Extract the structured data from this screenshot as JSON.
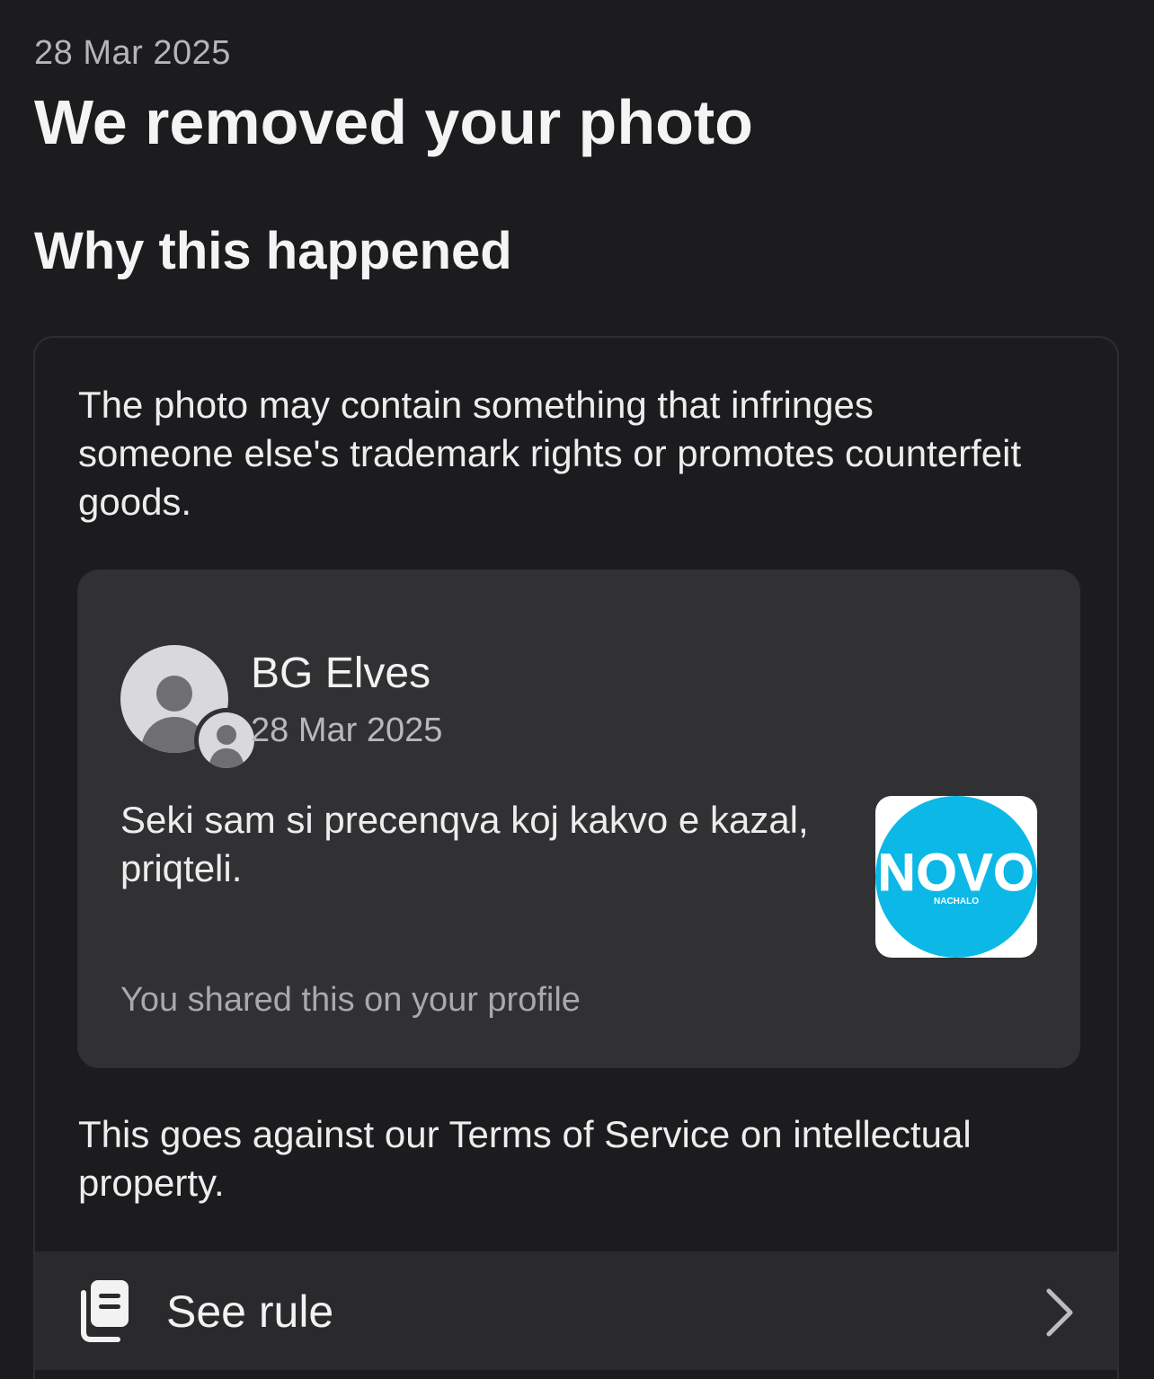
{
  "header": {
    "date": "28 Mar 2025",
    "title": "We removed your photo",
    "section_title": "Why this happened"
  },
  "card": {
    "reason": "The photo may contain something that infringes someone else's trademark rights or promotes counterfeit goods.",
    "post": {
      "author": "BG Elves",
      "date": "28 Mar 2025",
      "text": "Seki sam si precenqva koj kakvo e kazal, priqteli.",
      "thumbnail": {
        "word": "NOVO",
        "subtext": "NACHALO",
        "color": "#0bb8e6"
      },
      "shared_note": "You shared this on your profile"
    },
    "terms": "This goes against our Terms of Service on intellectual property.",
    "see_rule": {
      "label": "See rule",
      "icon": "rule-document-icon"
    }
  }
}
